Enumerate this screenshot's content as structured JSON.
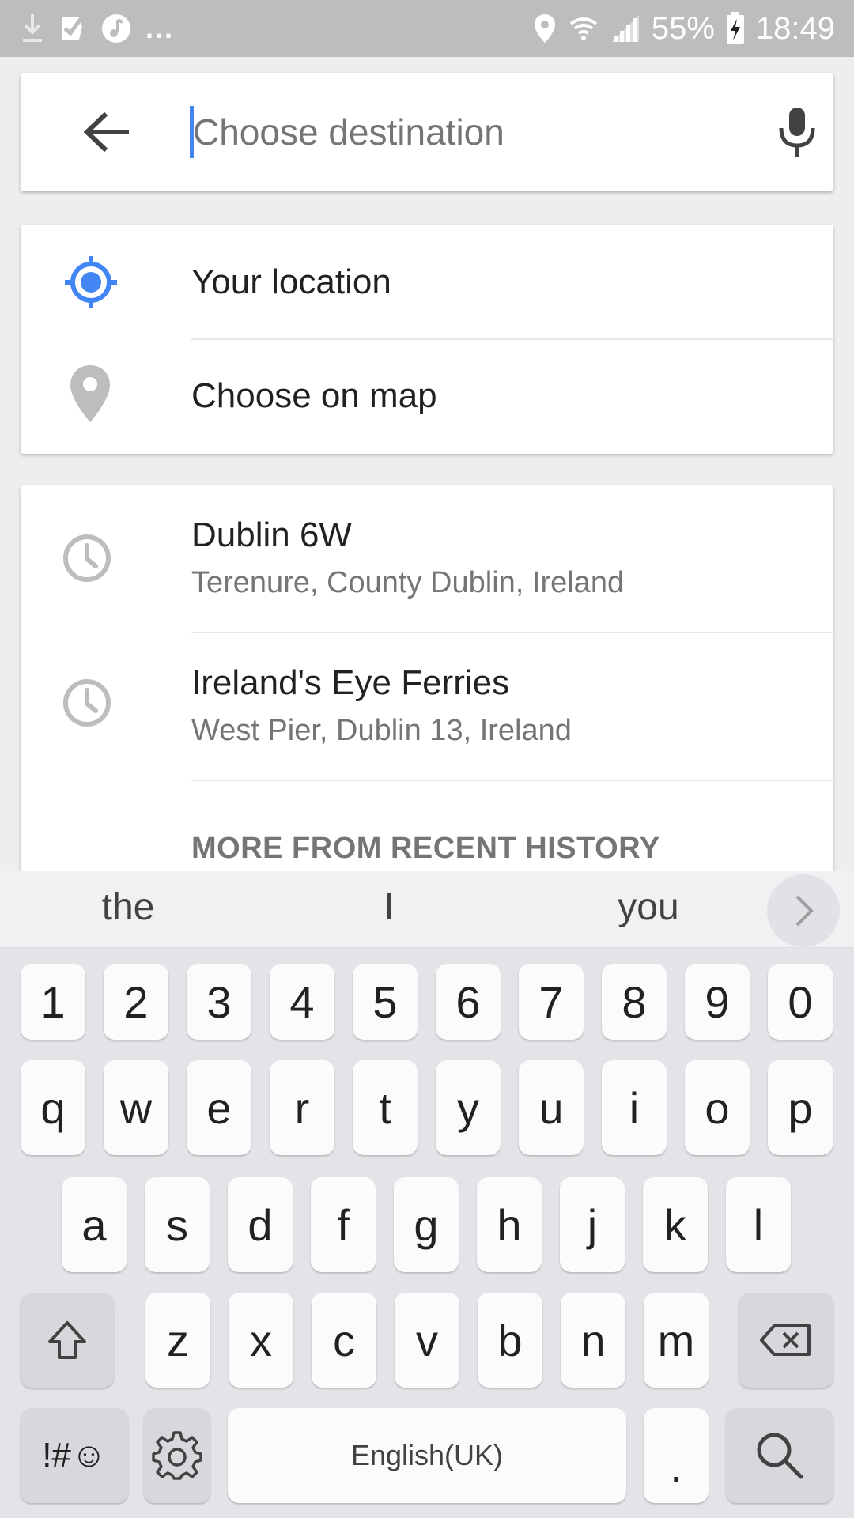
{
  "status_bar": {
    "battery": "55%",
    "time": "18:49",
    "more": "..."
  },
  "search": {
    "placeholder": "Choose destination",
    "value": ""
  },
  "quick_options": [
    {
      "label": "Your location",
      "icon": "my-location-icon"
    },
    {
      "label": "Choose on map",
      "icon": "map-pin-icon"
    }
  ],
  "history": {
    "items": [
      {
        "title": "Dublin 6W",
        "subtitle": "Terenure, County Dublin, Ireland"
      },
      {
        "title": "Ireland's Eye Ferries",
        "subtitle": "West Pier, Dublin 13, Ireland"
      }
    ],
    "more_label": "MORE FROM RECENT HISTORY"
  },
  "suggestions": [
    "the",
    "I",
    "you"
  ],
  "keyboard": {
    "numbers": [
      "1",
      "2",
      "3",
      "4",
      "5",
      "6",
      "7",
      "8",
      "9",
      "0"
    ],
    "row1": [
      "q",
      "w",
      "e",
      "r",
      "t",
      "y",
      "u",
      "i",
      "o",
      "p"
    ],
    "row2": [
      "a",
      "s",
      "d",
      "f",
      "g",
      "h",
      "j",
      "k",
      "l"
    ],
    "row3": [
      "z",
      "x",
      "c",
      "v",
      "b",
      "n",
      "m"
    ],
    "symbols_label": "!#☺",
    "space_label": "English(UK)",
    "period_label": "."
  },
  "colors": {
    "accent": "#4285f4",
    "status_bar": "#bdbdbd",
    "icon_grey": "#bdbdbd"
  }
}
